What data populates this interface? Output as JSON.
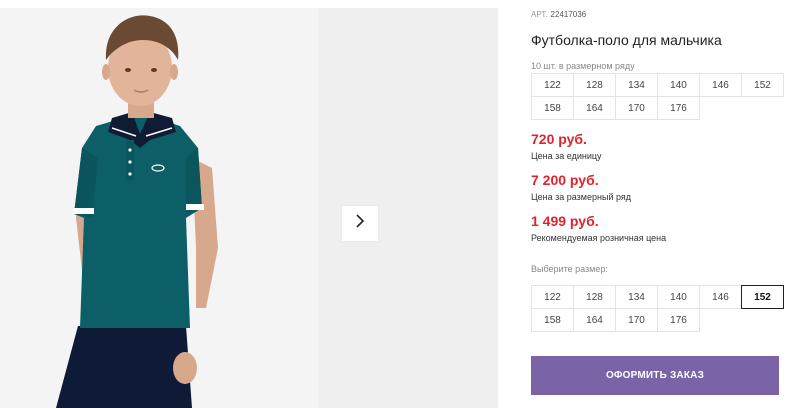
{
  "product": {
    "sku_label": "АРТ.",
    "sku": "22417036",
    "title": "Футболка-поло для мальчика",
    "pack_label": "10 шт. в размерном ряду",
    "pack_sizes": [
      "122",
      "128",
      "134",
      "140",
      "146",
      "152",
      "158",
      "164",
      "170",
      "176"
    ],
    "prices": [
      {
        "value": "720 руб.",
        "caption": "Цена за единицу"
      },
      {
        "value": "7 200 руб.",
        "caption": "Цена за размерный ряд"
      },
      {
        "value": "1 499 руб.",
        "caption": "Рекомендуемая розничная цена"
      }
    ],
    "choose_label": "Выберите размер:",
    "sizes": [
      "122",
      "128",
      "134",
      "140",
      "146",
      "152",
      "158",
      "164",
      "170",
      "176"
    ],
    "selected_size": "152",
    "order_label": "ОФОРМИТЬ ЗАКАЗ"
  },
  "gallery": {
    "next_icon": "chevron-right-icon"
  },
  "colors": {
    "price": "#e0232d",
    "order_button": "#7a63a7",
    "polo": "#0d5f67",
    "collar": "#111b33",
    "trousers": "#0f1a36"
  }
}
